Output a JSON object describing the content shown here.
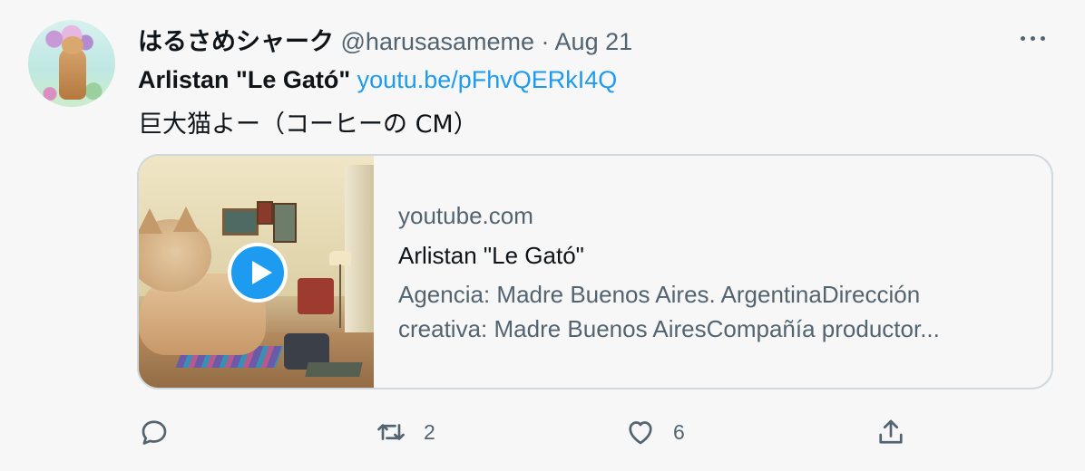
{
  "tweet": {
    "display_name": "はるさめシャーク",
    "handle": "@harusasameme",
    "separator": "·",
    "date": "Aug 21",
    "text_bold": "Arlistan \"Le Gató\"",
    "link": "youtu.be/pFhvQERkI4Q",
    "text_line2": "巨大猫よー（コーヒーの CM）"
  },
  "card": {
    "domain": "youtube.com",
    "title": "Arlistan \"Le Gató\"",
    "description_line1": "Agencia: Madre Buenos Aires. ArgentinaDirección",
    "description_line2": "creativa: Madre Buenos AiresCompañía productor..."
  },
  "actions": {
    "reply_count": "",
    "retweet_count": "2",
    "like_count": "6"
  },
  "colors": {
    "accent": "#1d9bf0",
    "secondary_text": "#536471",
    "border": "#cfd9de"
  },
  "icons": [
    "more-icon",
    "play-icon",
    "reply-icon",
    "retweet-icon",
    "like-icon",
    "share-icon"
  ]
}
